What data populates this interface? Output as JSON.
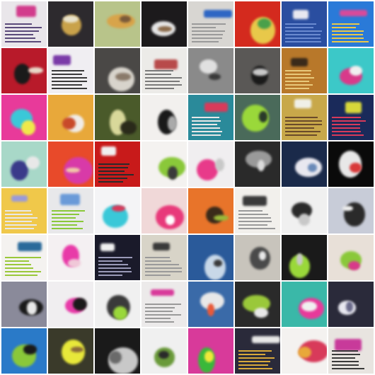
{
  "grid": {
    "rows": 8,
    "cols": 8,
    "tiles": [
      {
        "bg": "#e9e6ea",
        "accent": "#d23c8c",
        "detail": "#5a4a7a",
        "kind": "text"
      },
      {
        "bg": "#2d2a2e",
        "accent": "#c9a24a",
        "detail": "#e8e2cc",
        "kind": "object"
      },
      {
        "bg": "#b8c48a",
        "accent": "#d8a44a",
        "detail": "#7a5a3a",
        "kind": "object"
      },
      {
        "bg": "#1c1a1c",
        "accent": "#e6e6e6",
        "detail": "#8a6a4a",
        "kind": "object"
      },
      {
        "bg": "#d8d6d2",
        "accent": "#2e66c4",
        "detail": "#9a9a9a",
        "kind": "text"
      },
      {
        "bg": "#d42a1e",
        "accent": "#e8c84a",
        "detail": "#4aa04a",
        "kind": "object"
      },
      {
        "bg": "#2a4ea0",
        "accent": "#e8e8f0",
        "detail": "#6a8ad0",
        "kind": "text"
      },
      {
        "bg": "#2a7ad8",
        "accent": "#d84a9a",
        "detail": "#e8c84a",
        "kind": "text"
      },
      {
        "bg": "#b81a2a",
        "accent": "#1a1a1a",
        "detail": "#e8d8c8",
        "kind": "object"
      },
      {
        "bg": "#f0eef2",
        "accent": "#7a3aa8",
        "detail": "#3a3a3a",
        "kind": "text"
      },
      {
        "bg": "#4a4846",
        "accent": "#d8d4cc",
        "detail": "#8a7a6a",
        "kind": "object"
      },
      {
        "bg": "#ecebe8",
        "accent": "#b84a4a",
        "detail": "#7a7a7a",
        "kind": "text"
      },
      {
        "bg": "#8a8a8a",
        "accent": "#e0e0e0",
        "detail": "#3a3a3a",
        "kind": "object"
      },
      {
        "bg": "#5a5856",
        "accent": "#1a1a1a",
        "detail": "#c8c8c8",
        "kind": "object"
      },
      {
        "bg": "#b8782a",
        "accent": "#3a2a1a",
        "detail": "#e8c87a",
        "kind": "text"
      },
      {
        "bg": "#3cc8c8",
        "accent": "#d83a8a",
        "detail": "#f0f0f0",
        "kind": "object"
      },
      {
        "bg": "#e83a9a",
        "accent": "#3ac8d8",
        "detail": "#f0e84a",
        "kind": "object"
      },
      {
        "bg": "#e8a83a",
        "accent": "#f0ece8",
        "detail": "#c84a2a",
        "kind": "object"
      },
      {
        "bg": "#4a5a2a",
        "accent": "#d8d89a",
        "detail": "#2a2a1a",
        "kind": "object"
      },
      {
        "bg": "#f2f0ee",
        "accent": "#1a1a1a",
        "detail": "#aaaaaa",
        "kind": "object"
      },
      {
        "bg": "#2a8a9a",
        "accent": "#d83a5a",
        "detail": "#e8e8e8",
        "kind": "text"
      },
      {
        "bg": "#4a6a5a",
        "accent": "#9ad83a",
        "detail": "#2a3a2a",
        "kind": "object"
      },
      {
        "bg": "#c8a84a",
        "accent": "#f0f0e8",
        "detail": "#6a4a2a",
        "kind": "text"
      },
      {
        "bg": "#1a2a5a",
        "accent": "#d8d83a",
        "detail": "#d83a5a",
        "kind": "text"
      },
      {
        "bg": "#a8d8c8",
        "accent": "#3a3a8a",
        "detail": "#e8e8e8",
        "kind": "object"
      },
      {
        "bg": "#e84a2a",
        "accent": "#d83aa8",
        "detail": "#f0c8a8",
        "kind": "object"
      },
      {
        "bg": "#c81a1a",
        "accent": "#f0f0f0",
        "detail": "#2a2a2a",
        "kind": "text"
      },
      {
        "bg": "#f4f2f0",
        "accent": "#8ac83a",
        "detail": "#3a3a3a",
        "kind": "object"
      },
      {
        "bg": "#f0eef0",
        "accent": "#e83a8a",
        "detail": "#c8c8c8",
        "kind": "object"
      },
      {
        "bg": "#2a2a2a",
        "accent": "#9a9a9a",
        "detail": "#dadada",
        "kind": "object"
      },
      {
        "bg": "#1a2a4a",
        "accent": "#e8e8f0",
        "detail": "#6a8ab8",
        "kind": "object"
      },
      {
        "bg": "#0a0a0a",
        "accent": "#e8e8e8",
        "detail": "#d83a3a",
        "kind": "object"
      },
      {
        "bg": "#f0c84a",
        "accent": "#9a9ad8",
        "detail": "#e8e8e8",
        "kind": "text"
      },
      {
        "bg": "#e8e8ea",
        "accent": "#6a9ad8",
        "detail": "#8ac83a",
        "kind": "text"
      },
      {
        "bg": "#f4f4f6",
        "accent": "#3ac8d8",
        "detail": "#d83a5a",
        "kind": "object"
      },
      {
        "bg": "#f0d8d8",
        "accent": "#e83a7a",
        "detail": "#ffffff",
        "kind": "object"
      },
      {
        "bg": "#e8742a",
        "accent": "#3a2a1a",
        "detail": "#9ab83a",
        "kind": "object"
      },
      {
        "bg": "#f2f0ec",
        "accent": "#3a3a3a",
        "detail": "#9a9a9a",
        "kind": "text"
      },
      {
        "bg": "#f0f0f0",
        "accent": "#2a2a2a",
        "detail": "#c8c8c8",
        "kind": "object"
      },
      {
        "bg": "#c8ccd8",
        "accent": "#2a2a2a",
        "detail": "#f0f0f0",
        "kind": "object"
      },
      {
        "bg": "#f4f2f0",
        "accent": "#2a6a9a",
        "detail": "#9ac83a",
        "kind": "text"
      },
      {
        "bg": "#f4f0f2",
        "accent": "#e83aa8",
        "detail": "#f0c8d8",
        "kind": "object"
      },
      {
        "bg": "#1a1a2a",
        "accent": "#f0f0f0",
        "detail": "#9a9ab8",
        "kind": "text"
      },
      {
        "bg": "#d8d4c8",
        "accent": "#3a3a3a",
        "detail": "#9a9a9a",
        "kind": "text"
      },
      {
        "bg": "#2a5a9a",
        "accent": "#c8d8e8",
        "detail": "#3a3a3a",
        "kind": "object"
      },
      {
        "bg": "#c8c4bc",
        "accent": "#4a4a4a",
        "detail": "#e8e8e8",
        "kind": "object"
      },
      {
        "bg": "#1a1a1a",
        "accent": "#9ad83a",
        "detail": "#c8c8c8",
        "kind": "object"
      },
      {
        "bg": "#e8e0d8",
        "accent": "#8ac83a",
        "detail": "#d83a8a",
        "kind": "object"
      },
      {
        "bg": "#8a8a9a",
        "accent": "#1a1a1a",
        "detail": "#e8e8e8",
        "kind": "object"
      },
      {
        "bg": "#f0eef0",
        "accent": "#e83aa8",
        "detail": "#1a1a1a",
        "kind": "object"
      },
      {
        "bg": "#f0f0f0",
        "accent": "#3a3a3a",
        "detail": "#9ad83a",
        "kind": "object"
      },
      {
        "bg": "#eceaea",
        "accent": "#d83a9a",
        "detail": "#9a9a9a",
        "kind": "text"
      },
      {
        "bg": "#3a6aa8",
        "accent": "#e8e8e8",
        "detail": "#e85a3a",
        "kind": "object"
      },
      {
        "bg": "#2a2a2a",
        "accent": "#9ac83a",
        "detail": "#e8e8e8",
        "kind": "object"
      },
      {
        "bg": "#3ab8a8",
        "accent": "#e83a9a",
        "detail": "#f0f0f0",
        "kind": "object"
      },
      {
        "bg": "#2a2a3a",
        "accent": "#e8e8f0",
        "detail": "#6a6a8a",
        "kind": "object"
      },
      {
        "bg": "#2a7ac8",
        "accent": "#8ac83a",
        "detail": "#1a1a1a",
        "kind": "object"
      },
      {
        "bg": "#3a3a2a",
        "accent": "#e8e83a",
        "detail": "#8a6a3a",
        "kind": "object"
      },
      {
        "bg": "#1a1a1a",
        "accent": "#c8c8c8",
        "detail": "#6a6a6a",
        "kind": "object"
      },
      {
        "bg": "#f0f0f0",
        "accent": "#6a9a3a",
        "detail": "#2a2a2a",
        "kind": "object"
      },
      {
        "bg": "#d83a9a",
        "accent": "#3ab83a",
        "detail": "#f0e83a",
        "kind": "object"
      },
      {
        "bg": "#2a2a3a",
        "accent": "#e8e8e8",
        "detail": "#d8a83a",
        "kind": "text"
      },
      {
        "bg": "#f4f2f0",
        "accent": "#d83a5a",
        "detail": "#e8a83a",
        "kind": "object"
      },
      {
        "bg": "#e8e4e0",
        "accent": "#c83a9a",
        "detail": "#3a3a3a",
        "kind": "text"
      }
    ]
  }
}
